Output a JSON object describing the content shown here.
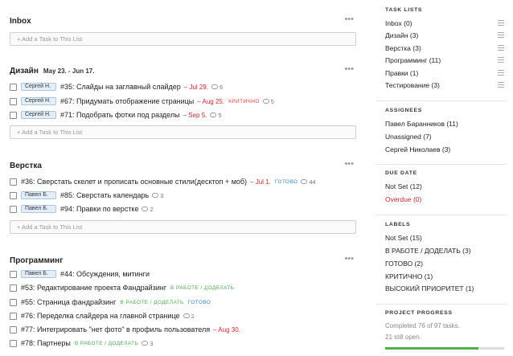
{
  "lists": [
    {
      "title": "Inbox",
      "dates": "",
      "add_task": "+ Add a Task to This List",
      "tasks": []
    },
    {
      "title": "Дизайн",
      "dates": "May 23. - Jun 17.",
      "add_task": "+ Add a Task to This List",
      "tasks": [
        {
          "assignee": "Сергей Н.",
          "title": "#35: Слайды на заглавный слайдер",
          "due": "– Jul 29.",
          "labels": [],
          "comments": "6"
        },
        {
          "assignee": "Сергей Н.",
          "title": "#67: Придумать отображение страницы",
          "due": "– Aug 25.",
          "labels": [
            {
              "text": "КРИТИЧНО",
              "color": "red"
            }
          ],
          "comments": "5"
        },
        {
          "assignee": "Сергей Н.",
          "title": "#71: Подобрать фотки под разделы",
          "due": "– Sep 5.",
          "labels": [],
          "comments": "5"
        }
      ]
    },
    {
      "title": "Верстка",
      "dates": "",
      "add_task": "+ Add a Task to This List",
      "tasks": [
        {
          "assignee": "",
          "title": "#36: Сверстать скелет и прописать основные стили(десктоп + моб)",
          "due": "– Jul 1.",
          "labels": [
            {
              "text": "ГОТОВО",
              "color": "blue"
            }
          ],
          "comments": "44"
        },
        {
          "assignee": "Павел Б.",
          "title": "#85: Сверстать календарь",
          "due": "",
          "labels": [],
          "comments": "3"
        },
        {
          "assignee": "Павел Б.",
          "title": "#94: Правки по верстке",
          "due": "",
          "labels": [],
          "comments": "2"
        }
      ]
    },
    {
      "title": "Программинг",
      "dates": "",
      "add_task": "",
      "tasks": [
        {
          "assignee": "Павел Б.",
          "title": "#44: Обсуждения, митинги",
          "due": "",
          "labels": [],
          "comments": ""
        },
        {
          "assignee": "",
          "title": "#53: Редактирование проекта Фандрайзинг",
          "due": "",
          "labels": [
            {
              "text": "В РАБОТЕ / ДОДЕЛАТЬ",
              "color": "green"
            }
          ],
          "comments": ""
        },
        {
          "assignee": "",
          "title": "#55: Страница фандрайзинг",
          "due": "",
          "labels": [
            {
              "text": "В РАБОТЕ / ДОДЕЛАТЬ",
              "color": "green"
            },
            {
              "text": "ГОТОВО",
              "color": "blue"
            }
          ],
          "comments": ""
        },
        {
          "assignee": "",
          "title": "#76: Переделка слайдера на главной странице",
          "due": "",
          "labels": [],
          "comments": "2"
        },
        {
          "assignee": "",
          "title": "#77: Интегрировать \"нет фото\" в профиль пользователя",
          "due": "– Aug 30.",
          "labels": [],
          "comments": ""
        },
        {
          "assignee": "",
          "title": "#78: Партнеры",
          "due": "",
          "labels": [
            {
              "text": "В РАБОТЕ / ДОДЕЛАТЬ",
              "color": "green"
            }
          ],
          "comments": "3"
        }
      ]
    }
  ],
  "more_glyph": "•••",
  "sidebar": {
    "task_lists": {
      "title": "TASK LISTS",
      "items": [
        "Inbox (0)",
        "Дизайн (3)",
        "Верстка (3)",
        "Программинг (11)",
        "Правки (1)",
        "Тестирование (3)"
      ]
    },
    "assignees": {
      "title": "ASSIGNEES",
      "items": [
        "Павел Баранников (11)",
        "Unassigned (7)",
        "Сергей Николаев (3)"
      ]
    },
    "due_date": {
      "title": "DUE DATE",
      "items": [
        "Not Set (12)",
        "Overdue (0)"
      ]
    },
    "labels": {
      "title": "LABELS",
      "items": [
        "Not Set (15)",
        "В РАБОТЕ / ДОДЕЛАТЬ (3)",
        "ГОТОВО (2)",
        "КРИТИЧНО (1)",
        "ВЫСОКИЙ ПРИОРИТЕТ (1)"
      ]
    },
    "progress": {
      "title": "PROJECT PROGRESS",
      "line1": "Completed 76 of 97 tasks.",
      "line2": "21 still open.",
      "fraction": 0.7835
    }
  },
  "colors": {
    "red": "#c62828",
    "green": "#4caf50",
    "blue": "#3f87c6",
    "assignee_bg": "#e3eef8"
  }
}
